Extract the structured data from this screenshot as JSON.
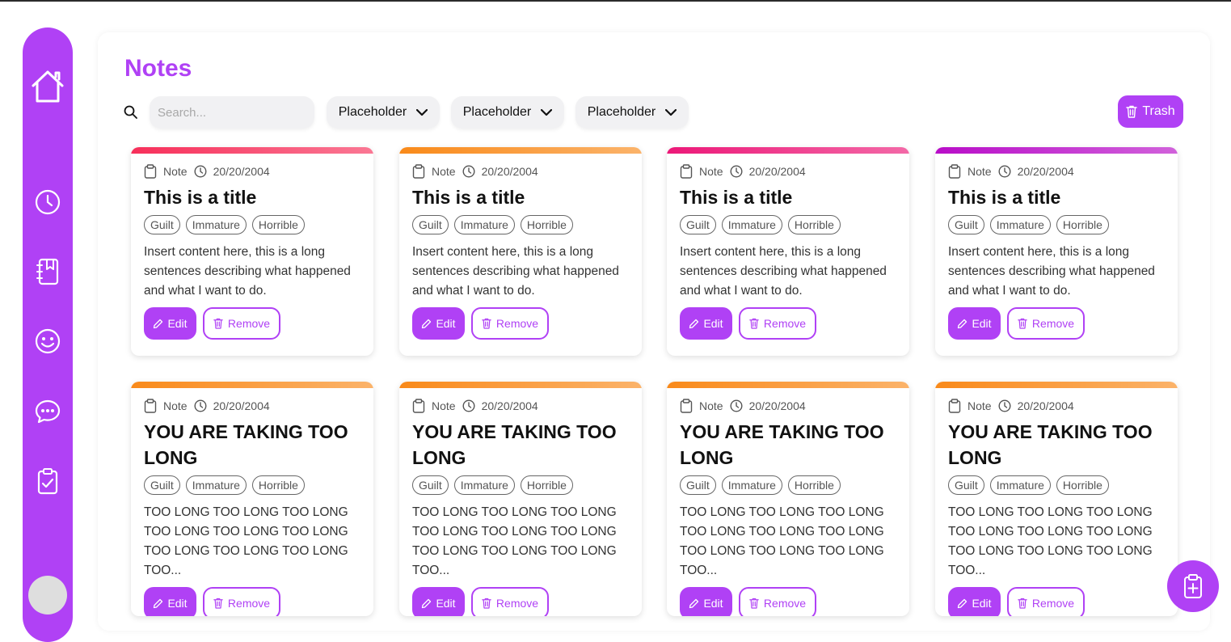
{
  "app": {
    "page_title": "Notes"
  },
  "sidebar": {
    "items": [
      {
        "icon": "home-icon"
      },
      {
        "icon": "clock-icon"
      },
      {
        "icon": "journal-icon"
      },
      {
        "icon": "smiley-icon"
      },
      {
        "icon": "chat-icon"
      },
      {
        "icon": "clipboard-check-icon"
      }
    ],
    "avatar": "avatar"
  },
  "toolbar": {
    "search_placeholder": "Search...",
    "filters": [
      "Placeholder",
      "Placeholder",
      "Placeholder"
    ],
    "trash_label": "Trash"
  },
  "cards": [
    {
      "type": "Note",
      "date": "20/20/2004",
      "title": "This is a title",
      "tags": [
        "Guilt",
        "Immature",
        "Horrible"
      ],
      "content": "Insert content here, this is a long sentences describing what happened and what I want to do.",
      "edit_label": "Edit",
      "remove_label": "Remove",
      "color": "#f72f5a"
    },
    {
      "type": "Note",
      "date": "20/20/2004",
      "title": "This is a title",
      "tags": [
        "Guilt",
        "Immature",
        "Horrible"
      ],
      "content": "Insert content here, this is a long sentences describing what happened and what I want to do.",
      "edit_label": "Edit",
      "remove_label": "Remove",
      "color": "#f98a1a"
    },
    {
      "type": "Note",
      "date": "20/20/2004",
      "title": "This is a title",
      "tags": [
        "Guilt",
        "Immature",
        "Horrible"
      ],
      "content": "Insert content here, this is a long sentences describing what happened and what I want to do.",
      "edit_label": "Edit",
      "remove_label": "Remove",
      "color": "#ec1878"
    },
    {
      "type": "Note",
      "date": "20/20/2004",
      "title": "This is a title",
      "tags": [
        "Guilt",
        "Immature",
        "Horrible"
      ],
      "content": "Insert content here, this is a long sentences describing what happened and what I want to do.",
      "edit_label": "Edit",
      "remove_label": "Remove",
      "color": "#b80dc8"
    },
    {
      "type": "Note",
      "date": "20/20/2004",
      "title": "YOU ARE TAKING TOO LONG",
      "tags": [
        "Guilt",
        "Immature",
        "Horrible"
      ],
      "content": "TOO LONG TOO LONG TOO LONG TOO LONG TOO LONG TOO LONG TOO LONG TOO LONG TOO LONG TOO...",
      "edit_label": "Edit",
      "remove_label": "Remove",
      "color": "#f98a1a"
    },
    {
      "type": "Note",
      "date": "20/20/2004",
      "title": "YOU ARE TAKING TOO LONG",
      "tags": [
        "Guilt",
        "Immature",
        "Horrible"
      ],
      "content": "TOO LONG TOO LONG TOO LONG TOO LONG TOO LONG TOO LONG TOO LONG TOO LONG TOO LONG TOO...",
      "edit_label": "Edit",
      "remove_label": "Remove",
      "color": "#f98a1a"
    },
    {
      "type": "Note",
      "date": "20/20/2004",
      "title": "YOU ARE TAKING TOO LONG",
      "tags": [
        "Guilt",
        "Immature",
        "Horrible"
      ],
      "content": "TOO LONG TOO LONG TOO LONG TOO LONG TOO LONG TOO LONG TOO LONG TOO LONG TOO LONG TOO...",
      "edit_label": "Edit",
      "remove_label": "Remove",
      "color": "#f98a1a"
    },
    {
      "type": "Note",
      "date": "20/20/2004",
      "title": "YOU ARE TAKING TOO LONG",
      "tags": [
        "Guilt",
        "Immature",
        "Horrible"
      ],
      "content": "TOO LONG TOO LONG TOO LONG TOO LONG TOO LONG TOO LONG TOO LONG TOO LONG TOO LONG TOO...",
      "edit_label": "Edit",
      "remove_label": "Remove",
      "color": "#f98a1a"
    }
  ],
  "fab": {
    "icon": "add-note-icon"
  },
  "colors": {
    "accent": "#b041f5"
  }
}
